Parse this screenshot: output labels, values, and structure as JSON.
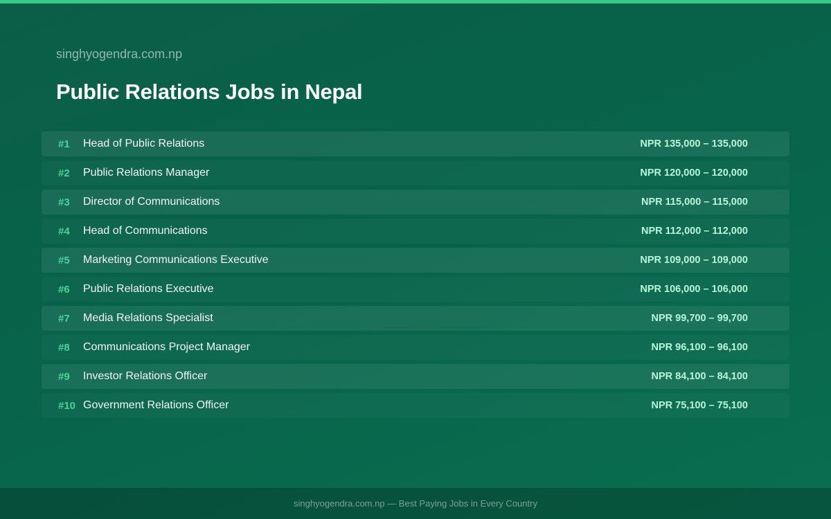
{
  "site": "singhyogendra.com.np",
  "title": "Public Relations Jobs in Nepal",
  "accent_color": "#35c98a",
  "jobs": [
    {
      "rank": "#1",
      "title": "Head of Public Relations",
      "salary": "NPR 135,000 – 135,000"
    },
    {
      "rank": "#2",
      "title": "Public Relations Manager",
      "salary": "NPR 120,000 – 120,000"
    },
    {
      "rank": "#3",
      "title": "Director of Communications",
      "salary": "NPR 115,000 – 115,000"
    },
    {
      "rank": "#4",
      "title": "Head of Communications",
      "salary": "NPR 112,000 – 112,000"
    },
    {
      "rank": "#5",
      "title": "Marketing Communications Executive",
      "salary": "NPR 109,000 – 109,000"
    },
    {
      "rank": "#6",
      "title": "Public Relations Executive",
      "salary": "NPR 106,000 – 106,000"
    },
    {
      "rank": "#7",
      "title": "Media Relations Specialist",
      "salary": "NPR 99,700 – 99,700"
    },
    {
      "rank": "#8",
      "title": "Communications Project Manager",
      "salary": "NPR 96,100 – 96,100"
    },
    {
      "rank": "#9",
      "title": "Investor Relations Officer",
      "salary": "NPR 84,100 – 84,100"
    },
    {
      "rank": "#10",
      "title": "Government Relations Officer",
      "salary": "NPR 75,100 – 75,100"
    }
  ],
  "footer": "singhyogendra.com.np — Best Paying Jobs in Every Country"
}
